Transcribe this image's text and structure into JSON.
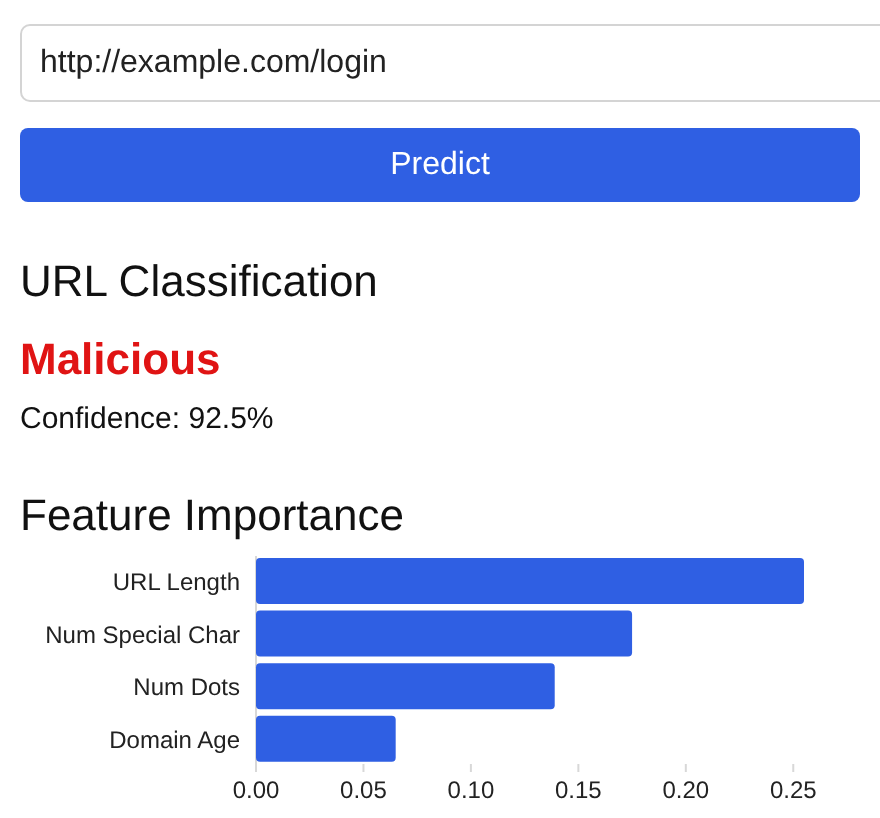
{
  "url_input": {
    "value": "http://example.com/login"
  },
  "predict_button": {
    "label": "Predict"
  },
  "classification": {
    "heading": "URL Classification",
    "result": "Malicious",
    "confidence": "Confidence: 92.5%"
  },
  "feature_importance": {
    "heading": "Feature Importance",
    "chart_data": {
      "type": "bar",
      "orientation": "horizontal",
      "categories": [
        "URL Length",
        "Num Special Char",
        "Num Dots",
        "Domain Age"
      ],
      "series": [
        {
          "color": "#2f5fe3",
          "values": [
            0.255,
            0.175,
            0.139,
            0.065
          ]
        }
      ],
      "xlim": [
        0,
        0.255
      ],
      "xticks": [
        {
          "value": 0,
          "label": "0.00"
        },
        {
          "value": 0.05,
          "label": "0.05"
        },
        {
          "value": 0.1,
          "label": "0.10"
        },
        {
          "value": 0.15,
          "label": "0.15"
        },
        {
          "value": 0.2,
          "label": "0.20"
        },
        {
          "value": 0.25,
          "label": "0.25"
        }
      ]
    }
  }
}
